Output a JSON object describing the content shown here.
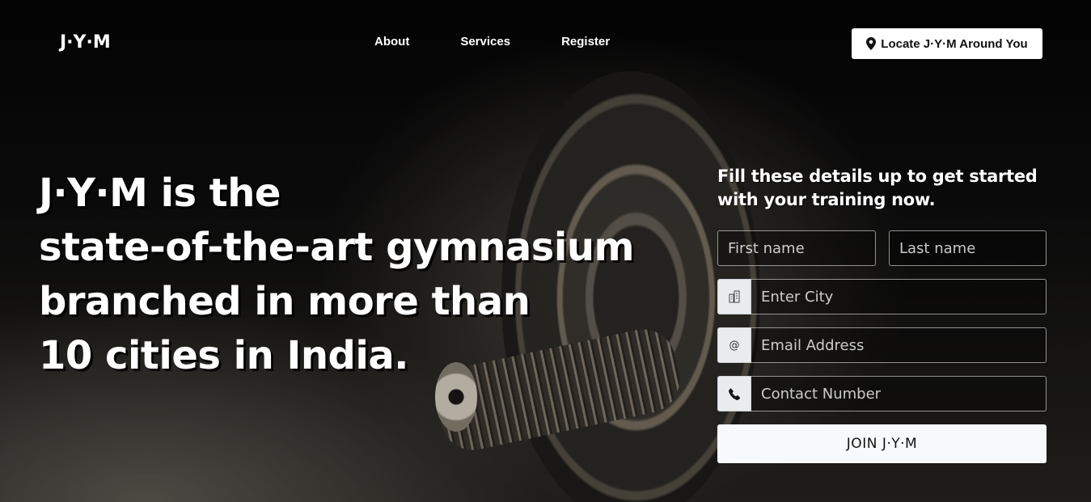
{
  "header": {
    "logo": "J·Y·M",
    "nav": [
      "About",
      "Services",
      "Register"
    ],
    "locate_label": "Locate J·Y·M Around You"
  },
  "hero": {
    "lines": [
      "J·Y·M is the",
      "state-of-the-art gymnasium",
      "branched in more than",
      "10 cities in India."
    ]
  },
  "form": {
    "title": "Fill these details up to get started with your training now.",
    "first_name_placeholder": "First name",
    "last_name_placeholder": "Last name",
    "city_placeholder": "Enter City",
    "email_placeholder": "Email Address",
    "email_addon": "@",
    "phone_placeholder": "Contact Number",
    "submit_label": "JOIN J·Y·M"
  }
}
